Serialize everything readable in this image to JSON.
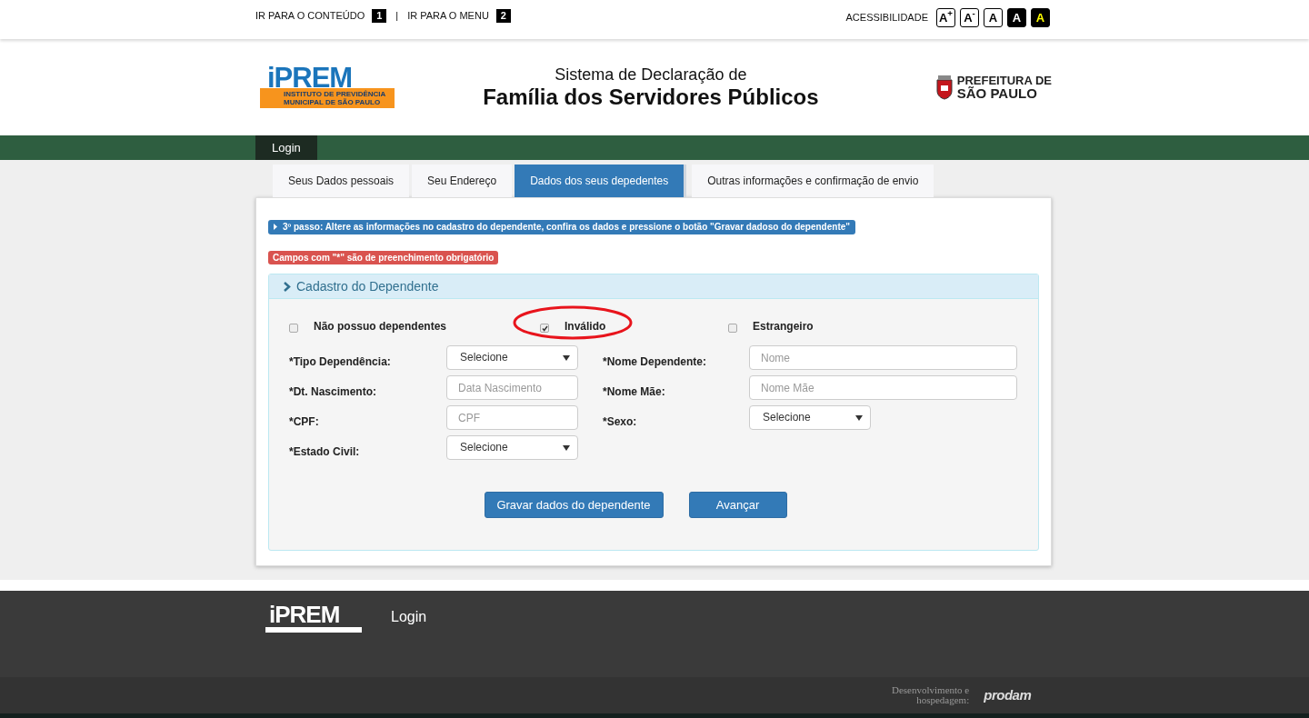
{
  "skip_links": [
    {
      "label": "IR PARA O CONTEÚDO",
      "key": "1"
    },
    {
      "label": "IR PARA O MENU",
      "key": "2"
    }
  ],
  "separator": "|",
  "accessibility": {
    "label": "ACESSIBILIDADE",
    "buttons": [
      {
        "label": "A$^{+}$",
        "kind": "outline"
      },
      {
        "label": "A$^{-}$",
        "kind": "outline"
      },
      {
        "label": "A",
        "kind": "outline"
      },
      {
        "label": "A",
        "kind": "dark"
      },
      {
        "label": "A",
        "kind": "contrast"
      }
    ]
  },
  "header": {
    "logo": {
      "name": "iPREM",
      "line1": "INSTITUTO DE PREVIDÊNCIA",
      "line2": "MUNICIPAL DE SÃO PAULO"
    },
    "title_line1": "Sistema de Declaração de",
    "title_line2": "Família dos Servidores Públicos",
    "partner_logo": {
      "line1": "PREFEITURA DE",
      "line2": "SÃO PAULO"
    }
  },
  "nav": [
    {
      "label": "Login",
      "selected": true
    }
  ],
  "tabs": [
    {
      "label": "Seus Dados pessoais",
      "selected": false
    },
    {
      "label": "Seu Endereço",
      "selected": false
    },
    {
      "label": "Dados dos seus depedentes",
      "selected": true
    },
    {
      "label": "Outras informações e confirmação de envio",
      "selected": false
    }
  ],
  "step_notice": "3º passo: Altere as informações no cadastro do dependente, confira os dados e pressione o botão \"Gravar dadoso do dependente\"",
  "required_notice": "Campos com \"*\" são de preenchimento obrigatório",
  "panel": {
    "title": "Cadastro do Dependente",
    "options": [
      {
        "label": "Não possuo dependentes",
        "checked": false,
        "highlighted": false
      },
      {
        "label": "Inválido",
        "checked": true,
        "highlighted": true
      },
      {
        "label": "Estrangeiro",
        "checked": false,
        "highlighted": false
      }
    ],
    "left_fields": [
      {
        "label": "*Tipo Dependência:",
        "kind": "select",
        "value": "Selecione"
      },
      {
        "label": "*Dt. Nascimento:",
        "kind": "input",
        "placeholder": "Data Nascimento"
      },
      {
        "label": "*CPF:",
        "kind": "input",
        "placeholder": "CPF"
      },
      {
        "label": "*Estado Civil:",
        "kind": "select",
        "value": "Selecione"
      }
    ],
    "right_fields": [
      {
        "label": "*Nome Dependente:",
        "kind": "input",
        "placeholder": "Nome"
      },
      {
        "label": "*Nome Mãe:",
        "kind": "input",
        "placeholder": "Nome Mãe"
      },
      {
        "label": "*Sexo:",
        "kind": "select",
        "value": "Selecione"
      }
    ],
    "buttons": [
      "Gravar dados do dependente",
      "Avançar"
    ]
  },
  "footer": {
    "logo": "iPREM",
    "link": "Login",
    "credit_line1": "Desenvolvimento e",
    "credit_line2": "hospedagem:",
    "credit_logo": "prodam"
  }
}
